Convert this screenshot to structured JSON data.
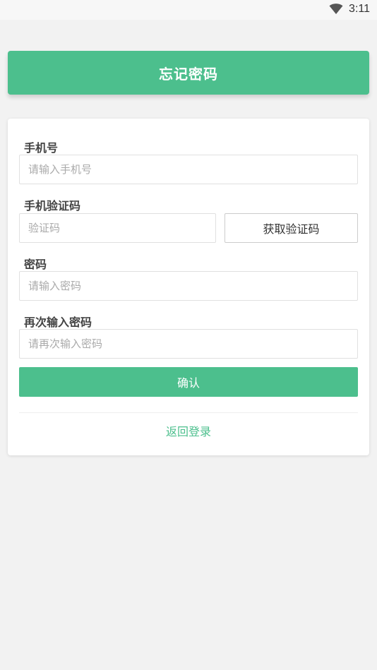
{
  "status_bar": {
    "time": "3:11",
    "icon": "wifi-icon"
  },
  "header": {
    "title": "忘记密码"
  },
  "form": {
    "phone": {
      "label": "手机号",
      "placeholder": "请输入手机号",
      "value": ""
    },
    "sms_code": {
      "label": "手机验证码",
      "placeholder": "验证码",
      "value": "",
      "button_label": "获取验证码"
    },
    "password": {
      "label": "密码",
      "placeholder": "请输入密码",
      "value": ""
    },
    "password_confirm": {
      "label": "再次输入密码",
      "placeholder": "请再次输入密码",
      "value": ""
    },
    "confirm_label": "确认",
    "back_link": "返回登录"
  },
  "colors": {
    "accent": "#4cbf8d",
    "background": "#f2f2f2",
    "card": "#ffffff"
  }
}
